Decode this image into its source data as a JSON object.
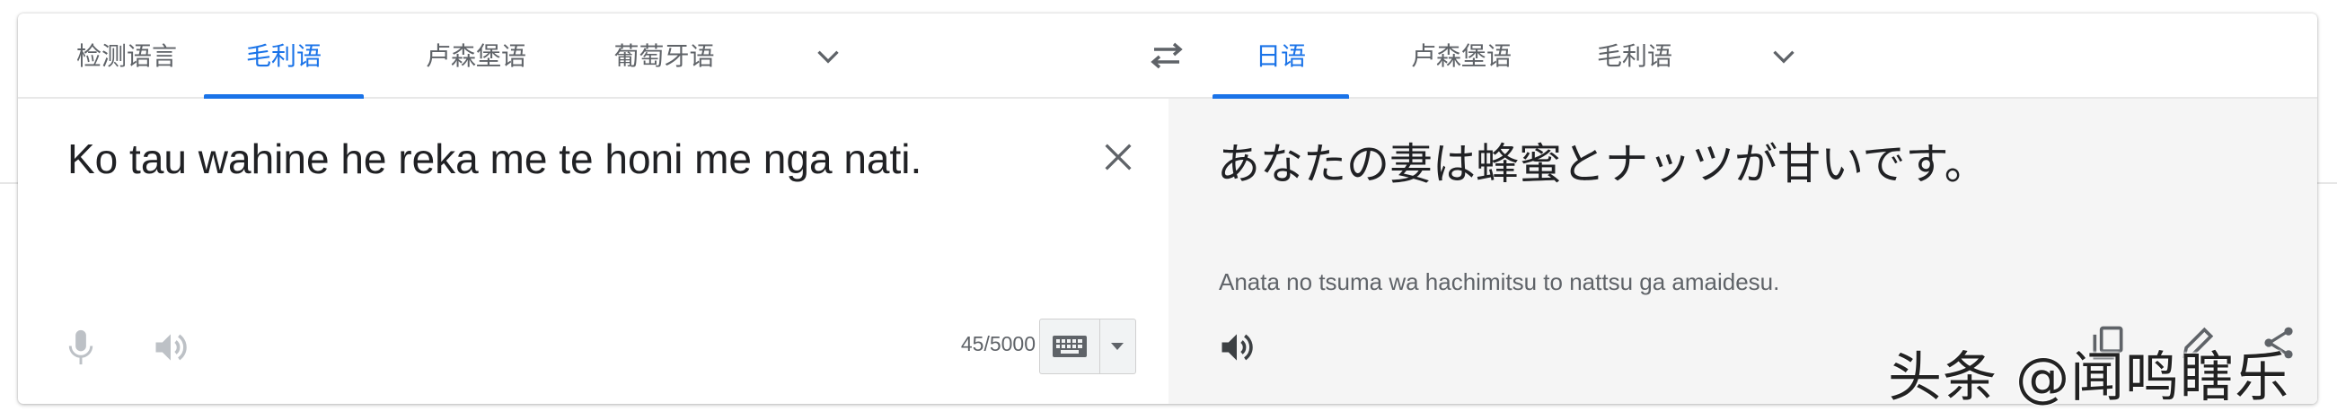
{
  "source": {
    "tabs": [
      {
        "label": "检测语言",
        "active": false
      },
      {
        "label": "毛利语",
        "active": true
      },
      {
        "label": "卢森堡语",
        "active": false
      },
      {
        "label": "葡萄牙语",
        "active": false
      }
    ],
    "text": "Ko tau wahine he reka me te honi me nga nati.",
    "char_count": "45/5000"
  },
  "target": {
    "tabs": [
      {
        "label": "日语",
        "active": true
      },
      {
        "label": "卢森堡语",
        "active": false
      },
      {
        "label": "毛利语",
        "active": false
      }
    ],
    "text": "あなたの妻は蜂蜜とナッツが甘いです。",
    "romanization": "Anata no tsuma wa hachimitsu to nattsu ga amaidesu."
  },
  "watermark": "头条 @闻鸣瞎乐",
  "colors": {
    "accent": "#1a73e8",
    "icon_disabled": "#bdc1c6",
    "icon": "#5f6368",
    "target_bg": "#f5f5f5"
  },
  "icons": [
    "chevron-down-icon",
    "swap-icon",
    "close-icon",
    "mic-icon",
    "speaker-icon",
    "keyboard-icon",
    "copy-icon",
    "edit-icon",
    "share-icon"
  ]
}
